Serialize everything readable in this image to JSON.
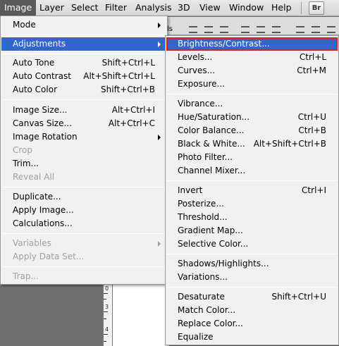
{
  "menubar": {
    "items": [
      "Image",
      "Layer",
      "Select",
      "Filter",
      "Analysis",
      "3D",
      "View",
      "Window",
      "Help"
    ],
    "br_button": "Br"
  },
  "image_menu": {
    "items": [
      {
        "label": "Mode",
        "shortcut": "",
        "submenu": true,
        "disabled": false
      },
      {
        "label": "Adjustments",
        "shortcut": "",
        "submenu": true,
        "disabled": false
      },
      {
        "label": "Auto Tone",
        "shortcut": "Shift+Ctrl+L",
        "submenu": false,
        "disabled": false
      },
      {
        "label": "Auto Contrast",
        "shortcut": "Alt+Shift+Ctrl+L",
        "submenu": false,
        "disabled": false
      },
      {
        "label": "Auto Color",
        "shortcut": "Shift+Ctrl+B",
        "submenu": false,
        "disabled": false
      },
      {
        "label": "Image Size...",
        "shortcut": "Alt+Ctrl+I",
        "submenu": false,
        "disabled": false
      },
      {
        "label": "Canvas Size...",
        "shortcut": "Alt+Ctrl+C",
        "submenu": false,
        "disabled": false
      },
      {
        "label": "Image Rotation",
        "shortcut": "",
        "submenu": true,
        "disabled": false
      },
      {
        "label": "Crop",
        "shortcut": "",
        "submenu": false,
        "disabled": true
      },
      {
        "label": "Trim...",
        "shortcut": "",
        "submenu": false,
        "disabled": false
      },
      {
        "label": "Reveal All",
        "shortcut": "",
        "submenu": false,
        "disabled": true
      },
      {
        "label": "Duplicate...",
        "shortcut": "",
        "submenu": false,
        "disabled": false
      },
      {
        "label": "Apply Image...",
        "shortcut": "",
        "submenu": false,
        "disabled": false
      },
      {
        "label": "Calculations...",
        "shortcut": "",
        "submenu": false,
        "disabled": false
      },
      {
        "label": "Variables",
        "shortcut": "",
        "submenu": true,
        "disabled": true
      },
      {
        "label": "Apply Data Set...",
        "shortcut": "",
        "submenu": false,
        "disabled": true
      },
      {
        "label": "Trap...",
        "shortcut": "",
        "submenu": false,
        "disabled": true
      }
    ]
  },
  "adjustments_menu": {
    "items": [
      {
        "label": "Brightness/Contrast...",
        "shortcut": ""
      },
      {
        "label": "Levels...",
        "shortcut": "Ctrl+L"
      },
      {
        "label": "Curves...",
        "shortcut": "Ctrl+M"
      },
      {
        "label": "Exposure...",
        "shortcut": ""
      },
      {
        "label": "Vibrance...",
        "shortcut": ""
      },
      {
        "label": "Hue/Saturation...",
        "shortcut": "Ctrl+U"
      },
      {
        "label": "Color Balance...",
        "shortcut": "Ctrl+B"
      },
      {
        "label": "Black & White...",
        "shortcut": "Alt+Shift+Ctrl+B"
      },
      {
        "label": "Photo Filter...",
        "shortcut": ""
      },
      {
        "label": "Channel Mixer...",
        "shortcut": ""
      },
      {
        "label": "Invert",
        "shortcut": "Ctrl+I"
      },
      {
        "label": "Posterize...",
        "shortcut": ""
      },
      {
        "label": "Threshold...",
        "shortcut": ""
      },
      {
        "label": "Gradient Map...",
        "shortcut": ""
      },
      {
        "label": "Selective Color...",
        "shortcut": ""
      },
      {
        "label": "Shadows/Highlights...",
        "shortcut": ""
      },
      {
        "label": "Variations...",
        "shortcut": ""
      },
      {
        "label": "Desaturate",
        "shortcut": "Shift+Ctrl+U"
      },
      {
        "label": "Match Color...",
        "shortcut": ""
      },
      {
        "label": "Replace Color...",
        "shortcut": ""
      },
      {
        "label": "Equalize",
        "shortcut": ""
      }
    ]
  },
  "ruler": {
    "marks": [
      "0",
      "3",
      "4"
    ]
  },
  "options_bar": {
    "fragment": "ls"
  },
  "colors": {
    "highlight": "#3366cc",
    "highlight_outline": "#e02020",
    "active_menu": "#5a5a5a"
  }
}
